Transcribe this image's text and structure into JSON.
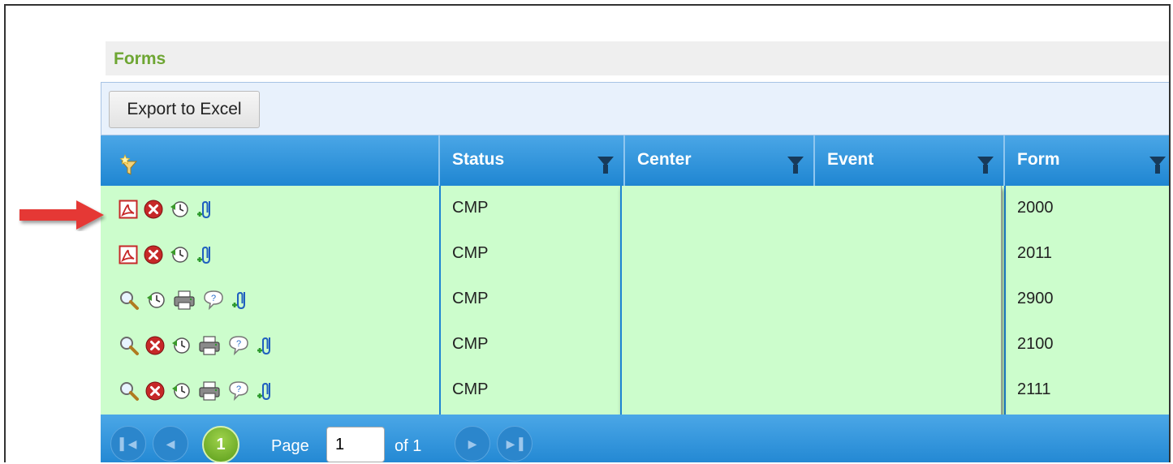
{
  "panel": {
    "title": "Forms"
  },
  "toolbar": {
    "export_label": "Export to Excel"
  },
  "columns": [
    {
      "label": "Status"
    },
    {
      "label": "Center"
    },
    {
      "label": "Event"
    },
    {
      "label": "Form"
    }
  ],
  "rows": [
    {
      "status": "CMP",
      "form": "2000",
      "icons": [
        "pdf-icon",
        "delete-icon",
        "history-icon",
        "attach-icon"
      ]
    },
    {
      "status": "CMP",
      "form": "2011",
      "icons": [
        "pdf-icon",
        "delete-icon",
        "history-icon",
        "attach-icon"
      ]
    },
    {
      "status": "CMP",
      "form": "2900",
      "icons": [
        "view-icon",
        "history-icon",
        "print-icon",
        "comment-icon",
        "attach-icon"
      ]
    },
    {
      "status": "CMP",
      "form": "2100",
      "icons": [
        "view-icon",
        "delete-icon",
        "history-icon",
        "print-icon",
        "comment-icon",
        "attach-icon"
      ]
    },
    {
      "status": "CMP",
      "form": "2111",
      "icons": [
        "view-icon",
        "delete-icon",
        "history-icon",
        "print-icon",
        "comment-icon",
        "attach-icon"
      ]
    }
  ],
  "pager": {
    "current_page": "1",
    "page_label": "Page",
    "page_value": "1",
    "of_label": "of 1"
  },
  "colors": {
    "row_bg": "#ccfdcc",
    "header_blue": "#2a8ed8",
    "title_green": "#6ea633",
    "arrow_red": "#e53935"
  }
}
